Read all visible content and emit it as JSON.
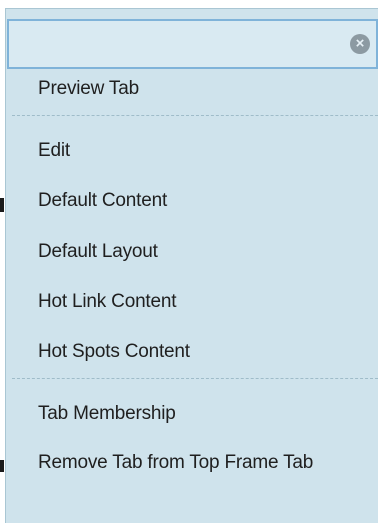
{
  "menu": {
    "close_glyph": "×",
    "groups": [
      {
        "items": [
          "Preview Tab"
        ]
      },
      {
        "items": [
          "Edit",
          "Default Content",
          "Default Layout",
          "Hot Link Content",
          "Hot Spots Content"
        ]
      },
      {
        "items": [
          "Tab Membership",
          "Remove Tab from Top Frame Tab"
        ]
      }
    ]
  },
  "colors": {
    "menu_bg": "#cfe3ec",
    "header_border": "#7fb3d9",
    "text": "#1f1f1f"
  }
}
